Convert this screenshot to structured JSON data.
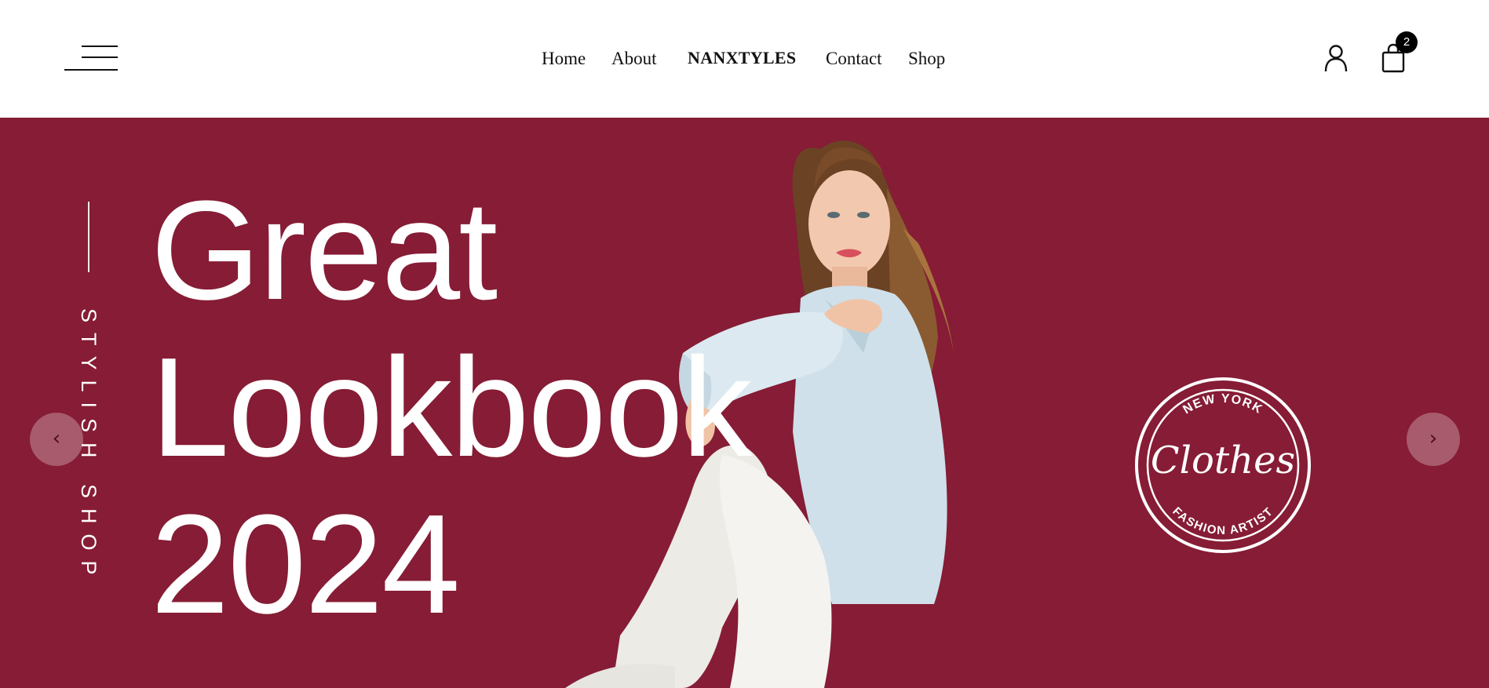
{
  "header": {
    "menu_icon": "hamburger-menu-icon",
    "nav": {
      "home": "Home",
      "about": "About",
      "brand": "NANXTYLES",
      "contact": "Contact",
      "shop": "Shop"
    },
    "user_icon": "user-icon",
    "cart_icon": "shopping-bag-icon",
    "cart_count": "2"
  },
  "hero": {
    "background_color": "#861c35",
    "side_label": "STYLISH SHOP",
    "headline": [
      "Great",
      "Lookbook",
      "2024"
    ],
    "badge": {
      "top_text": "NEW YORK",
      "script_text": "Clothes",
      "bottom_text": "FASHION ARTIST"
    },
    "prev_glyph": "‹",
    "next_glyph": "›"
  }
}
